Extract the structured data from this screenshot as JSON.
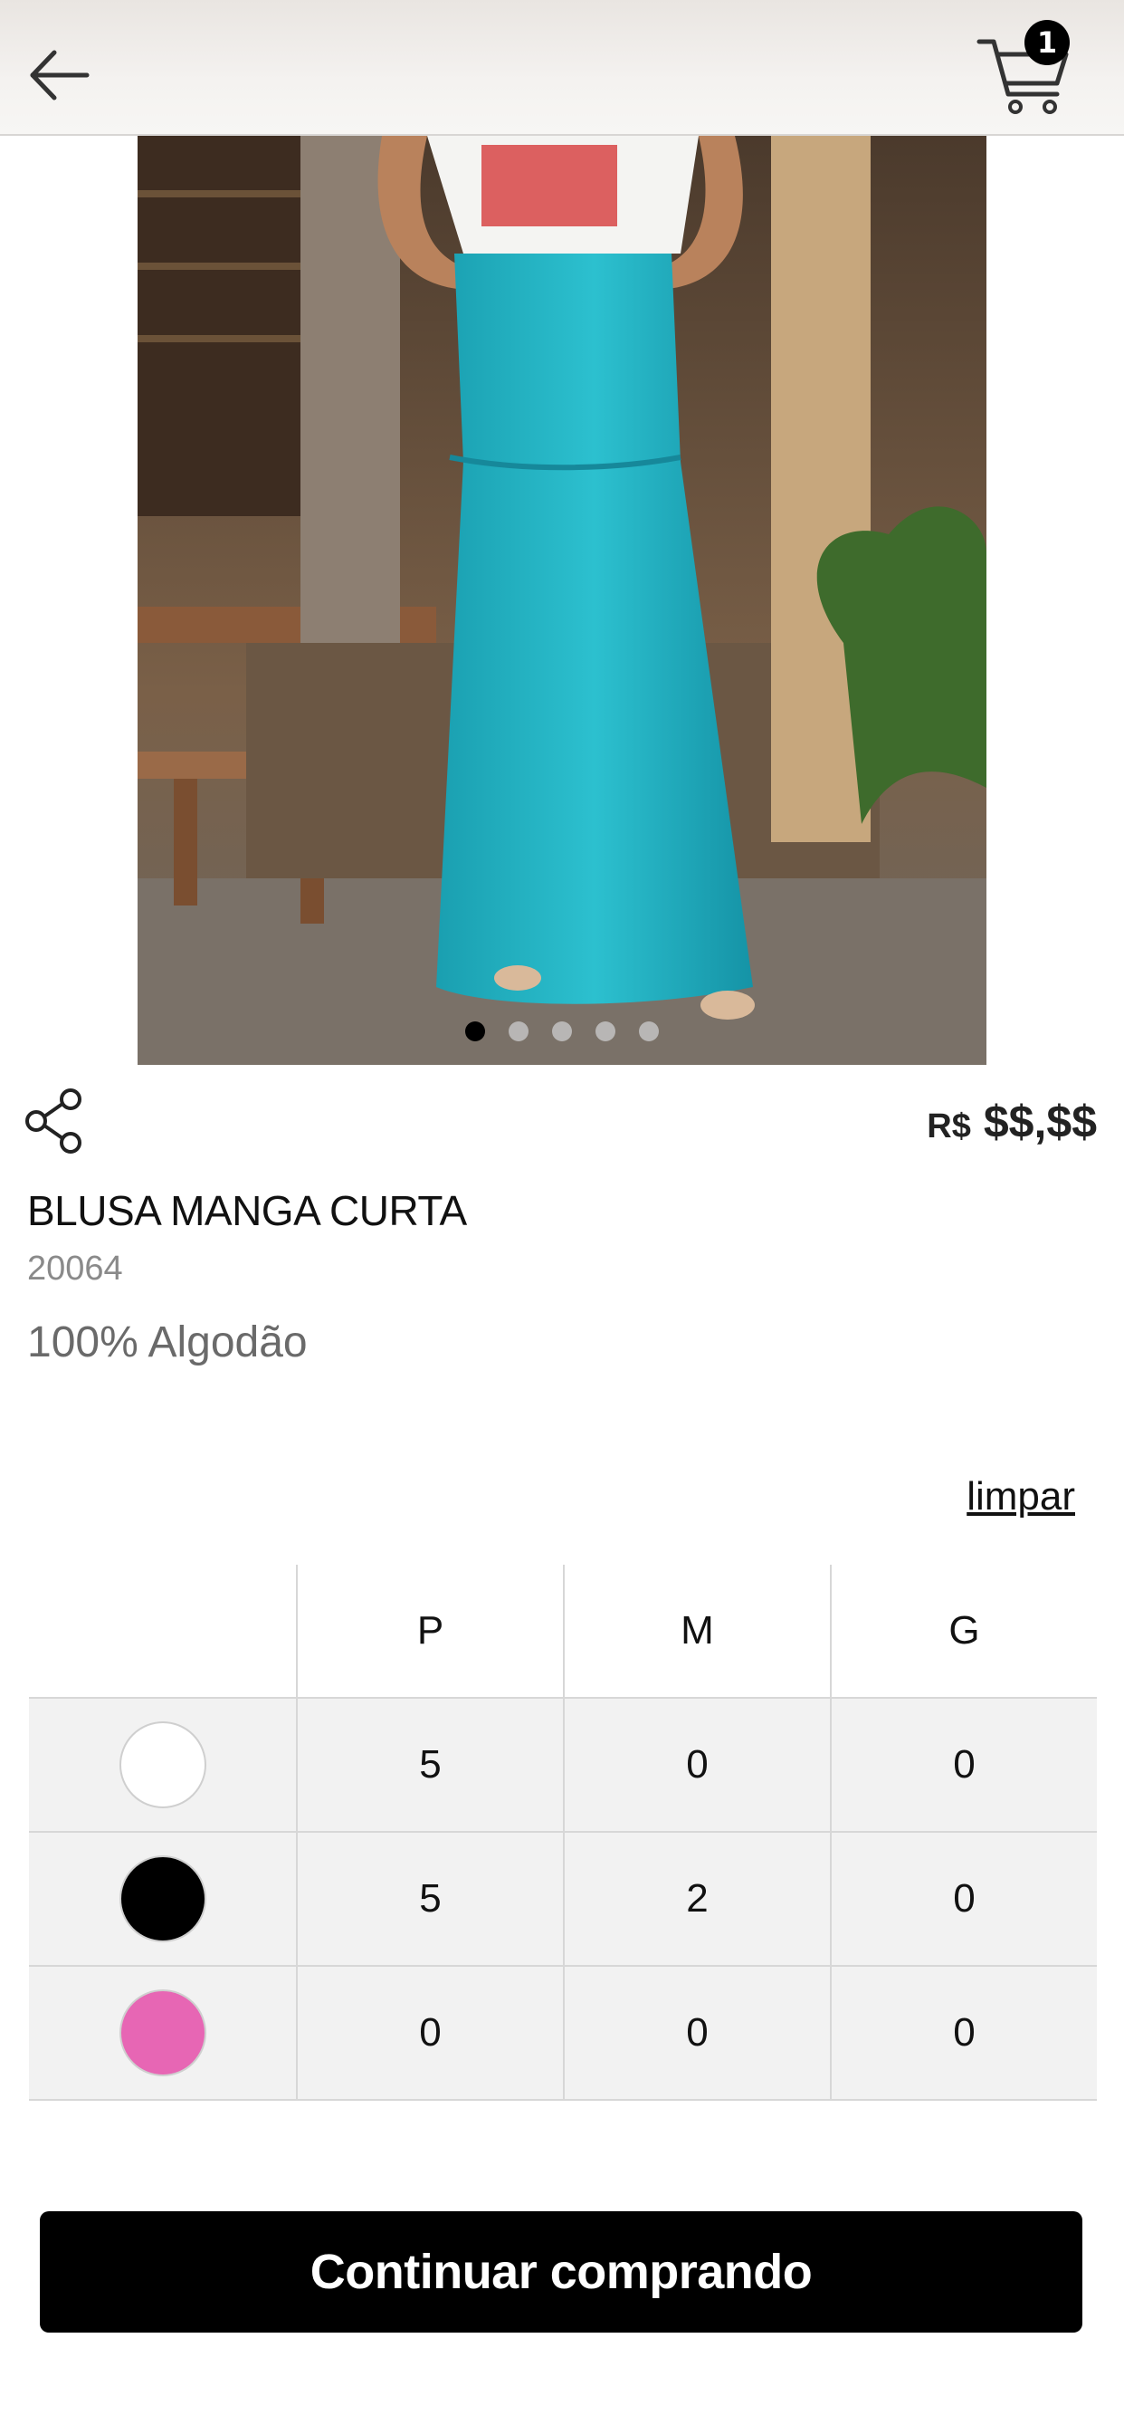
{
  "header": {
    "back_icon": "arrow-left-icon",
    "cart_icon": "cart-icon",
    "cart_count": "1"
  },
  "gallery": {
    "total_images": 5,
    "active_index": 0
  },
  "product": {
    "currency": "R$",
    "price": "$$,$$",
    "title": "BLUSA MANGA CURTA",
    "reference": "20064",
    "material": "100% Algodão"
  },
  "grid": {
    "clear_label": "limpar",
    "sizes": [
      "P",
      "M",
      "G"
    ],
    "rows": [
      {
        "color": "#ffffff",
        "quantities": [
          "5",
          "0",
          "0"
        ]
      },
      {
        "color": "#000000",
        "quantities": [
          "5",
          "2",
          "0"
        ]
      },
      {
        "color": "#e766b4",
        "quantities": [
          "0",
          "0",
          "0"
        ]
      }
    ]
  },
  "actions": {
    "continue_label": "Continuar comprando"
  }
}
